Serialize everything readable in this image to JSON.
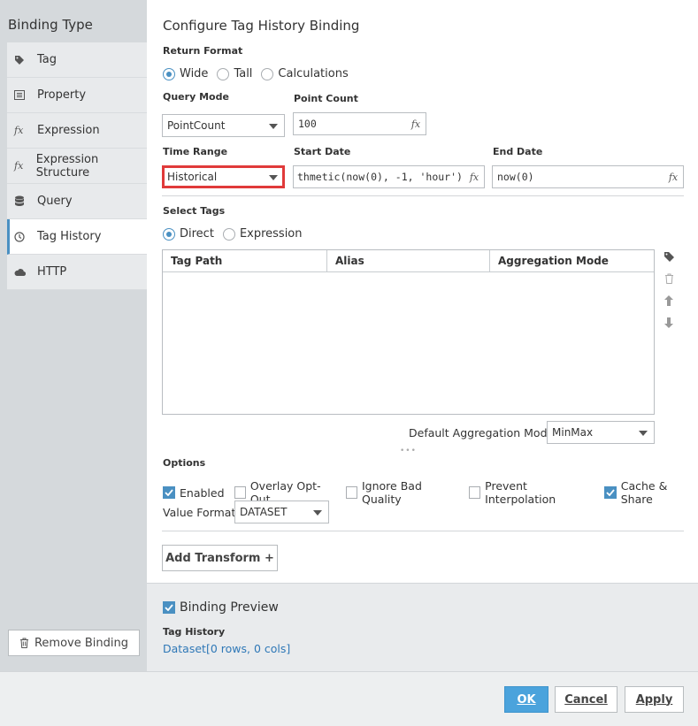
{
  "sidebar": {
    "title": "Binding Type",
    "items": [
      {
        "label": "Tag",
        "icon": "tag-icon"
      },
      {
        "label": "Property",
        "icon": "property-icon"
      },
      {
        "label": "Expression",
        "icon": "fx-icon"
      },
      {
        "label": "Expression Structure",
        "icon": "fx-icon"
      },
      {
        "label": "Query",
        "icon": "database-icon"
      },
      {
        "label": "Tag History",
        "icon": "clock-icon",
        "active": true
      },
      {
        "label": "HTTP",
        "icon": "cloud-icon"
      }
    ],
    "remove_label": "Remove Binding"
  },
  "main": {
    "title": "Configure Tag History Binding",
    "return_format": {
      "label": "Return Format",
      "options": [
        "Wide",
        "Tall",
        "Calculations"
      ],
      "selected": "Wide"
    },
    "query_mode": {
      "label": "Query Mode",
      "value": "PointCount"
    },
    "point_count": {
      "label": "Point Count",
      "value": "100"
    },
    "time_range": {
      "label": "Time Range",
      "value": "Historical"
    },
    "start_date": {
      "label": "Start Date",
      "value": "thmetic(now(0), -1, 'hour')"
    },
    "end_date": {
      "label": "End Date",
      "value": "now(0)"
    },
    "select_tags": {
      "label": "Select Tags",
      "options": [
        "Direct",
        "Expression"
      ],
      "selected": "Direct"
    },
    "table": {
      "columns": [
        "Tag Path",
        "Alias",
        "Aggregation Mode"
      ],
      "rows": []
    },
    "default_aggregation": {
      "label": "Default Aggregation Mode",
      "value": "MinMax"
    },
    "options": {
      "label": "Options",
      "checks": [
        {
          "label": "Enabled",
          "checked": true
        },
        {
          "label": "Overlay Opt-Out",
          "checked": false
        },
        {
          "label": "Ignore Bad Quality",
          "checked": false
        },
        {
          "label": "Prevent Interpolation",
          "checked": false
        },
        {
          "label": "Cache & Share",
          "checked": true
        }
      ]
    },
    "value_format": {
      "label": "Value Format",
      "value": "DATASET"
    },
    "add_transform_label": "Add Transform +",
    "fx_glyph": "fx",
    "more_dots": "•••"
  },
  "preview": {
    "checkbox_label": "Binding Preview",
    "checked": true,
    "section_label": "Tag History",
    "value": "Dataset[0 rows, 0 cols]"
  },
  "footer": {
    "ok": "OK",
    "cancel": "Cancel",
    "apply": "Apply"
  },
  "colors": {
    "accent": "#4a90c2",
    "primary_button": "#4ba3dc",
    "highlight_box": "#e03a3a",
    "link": "#2f78b7"
  }
}
